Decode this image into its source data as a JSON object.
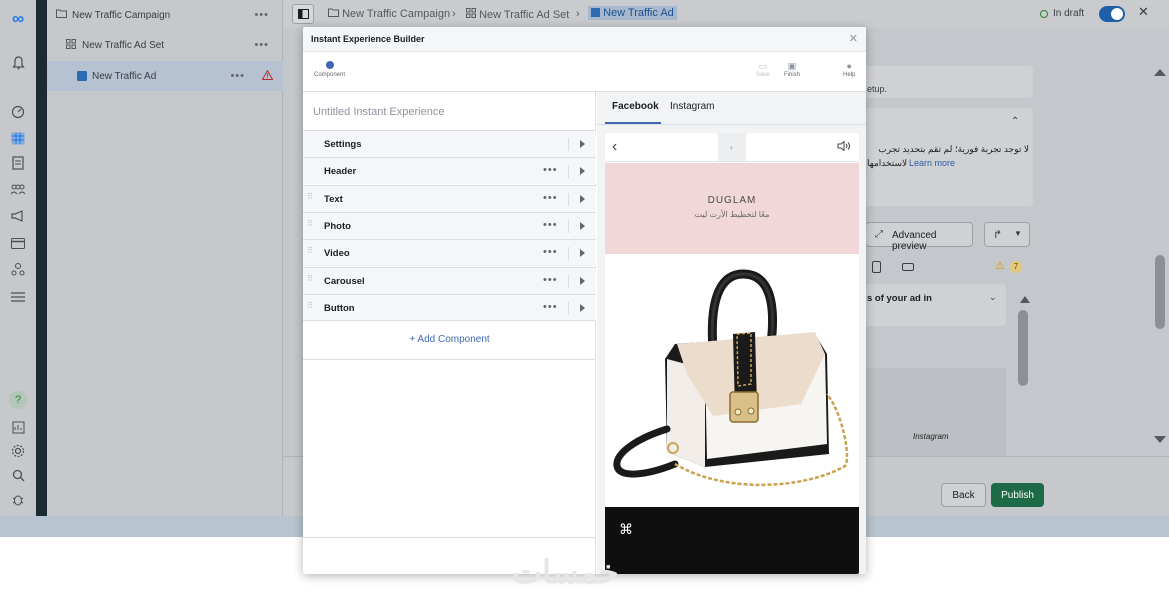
{
  "meta_logo": "∞",
  "tree": {
    "campaign": "New Traffic Campaign",
    "adset": "New Traffic Ad Set",
    "ad": "New Traffic Ad"
  },
  "breadcrumb": {
    "campaign": "New Traffic Campaign",
    "adset": "New Traffic Ad Set",
    "ad": "New Traffic Ad"
  },
  "status": {
    "label": "In draft"
  },
  "background": {
    "setup_text": "etup.",
    "arabic_notice": "لا توجد تجربة فورية؛ لم تقم بتحديد تجرب",
    "arabic_notice_2": "لاستخدامها",
    "learn_more": "Learn more",
    "advanced_preview": "Advanced preview",
    "warnings_count": "7",
    "placements_text": "s of your ad in",
    "instagram_label": "Instagram"
  },
  "footer": {
    "back_label": "Back",
    "publish_label": "Publish"
  },
  "modal": {
    "title": "Instant Experience Builder",
    "toolbar": {
      "component": "Component",
      "save": "Save",
      "finish": "Finish",
      "help": "Help"
    },
    "experience_name_placeholder": "Untitled Instant Experience",
    "components": [
      {
        "label": "Settings",
        "has_menu": false,
        "draggable": false
      },
      {
        "label": "Header",
        "has_menu": true,
        "draggable": false
      },
      {
        "label": "Text",
        "has_menu": true,
        "draggable": true
      },
      {
        "label": "Photo",
        "has_menu": true,
        "draggable": true
      },
      {
        "label": "Video",
        "has_menu": true,
        "draggable": true
      },
      {
        "label": "Carousel",
        "has_menu": true,
        "draggable": true
      },
      {
        "label": "Button",
        "has_menu": true,
        "draggable": true
      }
    ],
    "add_component": "+ Add Component",
    "preview_tabs": [
      "Facebook",
      "Instagram"
    ],
    "preview": {
      "brand": "DUGLAM",
      "tagline": "معًا لتخطيط الأرت ليت"
    }
  },
  "watermark": "خمسات",
  "colors": {
    "accent": "#4267b2",
    "publish": "#1c6b46",
    "banner": "#f2d7d8",
    "rail_dark": "#1c2b33"
  }
}
